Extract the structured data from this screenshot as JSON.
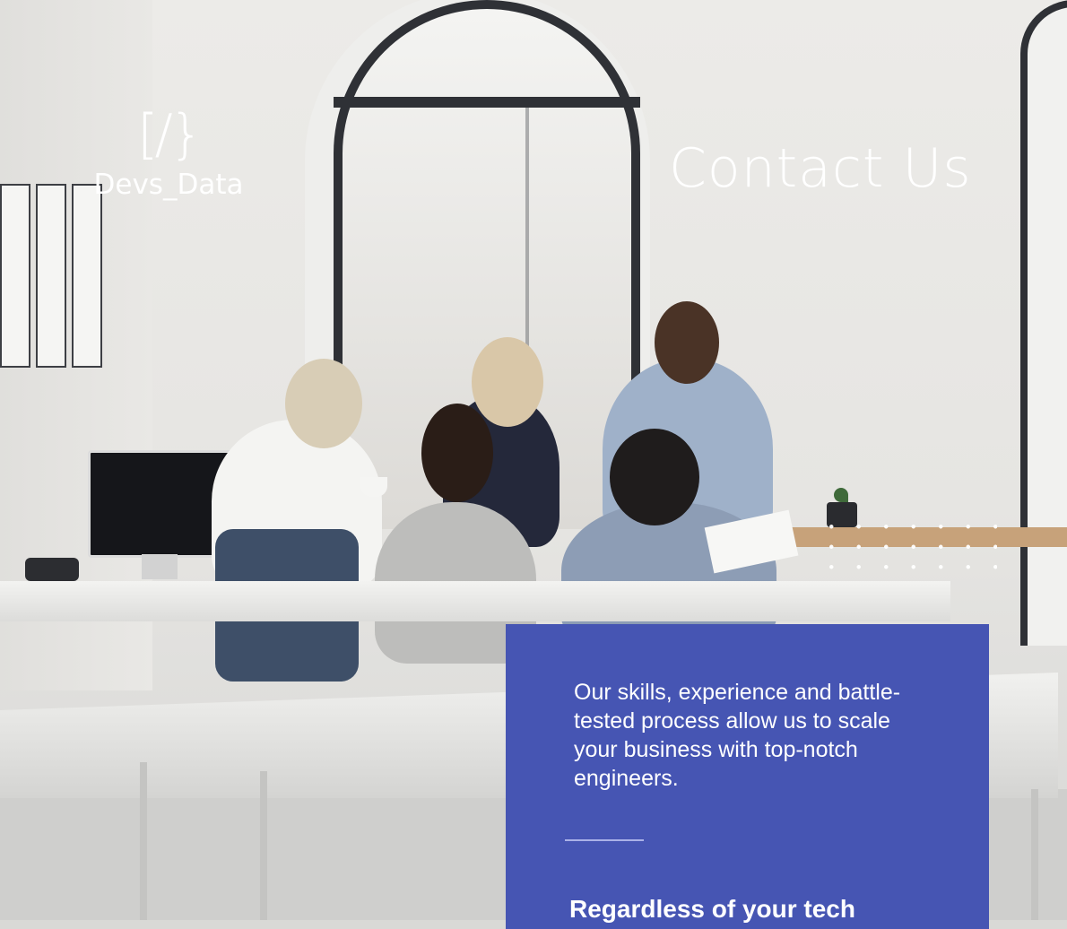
{
  "brand": {
    "logo_mark": "[/}",
    "name": "Devs_Data"
  },
  "page": {
    "title": "Contact Us"
  },
  "info_card": {
    "text": "Our skills, experience and battle-tested process allow us to scale your business with top-notch engineers.",
    "heading": "Regardless of your tech"
  },
  "colors": {
    "card_background": "#4655b3",
    "text": "#ffffff"
  },
  "background_image": "office-team-meeting-photo"
}
